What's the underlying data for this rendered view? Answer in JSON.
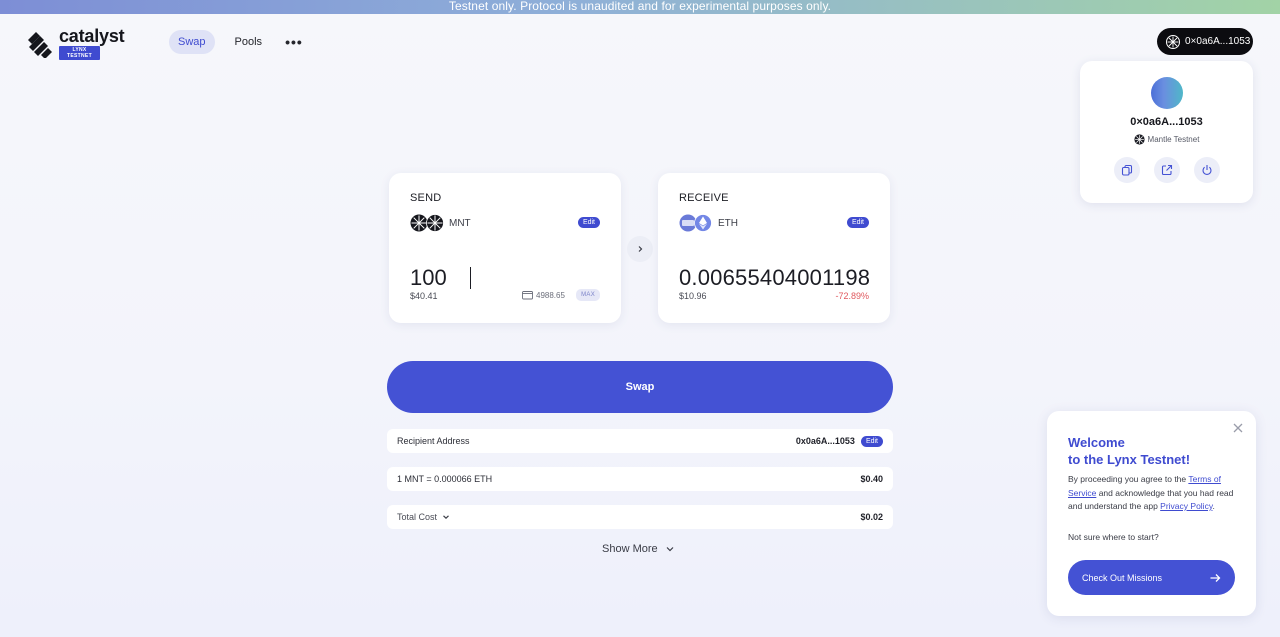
{
  "banner": {
    "text": "Testnet only. Protocol is unaudited and for experimental purposes only."
  },
  "header": {
    "logo_name": "catalyst",
    "logo_badge": "LYNX TESTNET",
    "nav": [
      {
        "label": "Swap",
        "active": true
      },
      {
        "label": "Pools",
        "active": false
      }
    ],
    "more_label": "•••",
    "wallet_label": "0×0a6A...1053"
  },
  "account": {
    "address": "0×0a6A...1053",
    "network": "Mantle Testnet",
    "actions": [
      {
        "icon": "copy-icon"
      },
      {
        "icon": "external-link-icon"
      },
      {
        "icon": "power-icon"
      }
    ]
  },
  "send": {
    "title": "SEND",
    "token": "MNT",
    "edit_label": "Edit",
    "amount": "100",
    "usd": "$40.41",
    "balance": "4988.65",
    "max_label": "MAX"
  },
  "receive": {
    "title": "RECEIVE",
    "token": "ETH",
    "edit_label": "Edit",
    "amount": "0.006554040011986",
    "usd": "$10.96",
    "change": "-72.89%"
  },
  "swap_button": {
    "label": "Swap"
  },
  "details": {
    "recipient_label": "Recipient Address",
    "recipient_value": "0x0a6A...1053",
    "recipient_edit": "Edit",
    "rate_label": "1 MNT = 0.000066 ETH",
    "rate_value": "$0.40",
    "total_label": "Total Cost",
    "total_value": "$0.02",
    "show_more": "Show More"
  },
  "welcome": {
    "title_line1": "Welcome",
    "title_line2": "to the Lynx Testnet!",
    "body_pre": "By proceeding you agree to the ",
    "terms_link": "Terms of Service",
    "body_mid": " and acknowledge that you had read and understand the app ",
    "privacy_link": "Privacy Policy",
    "body_post": ".",
    "question": "Not sure where to start?",
    "cta_label": "Check Out Missions"
  },
  "colors": {
    "accent": "#4452d4",
    "negative": "#e0585e",
    "wallet_bg": "#0c0c10"
  }
}
